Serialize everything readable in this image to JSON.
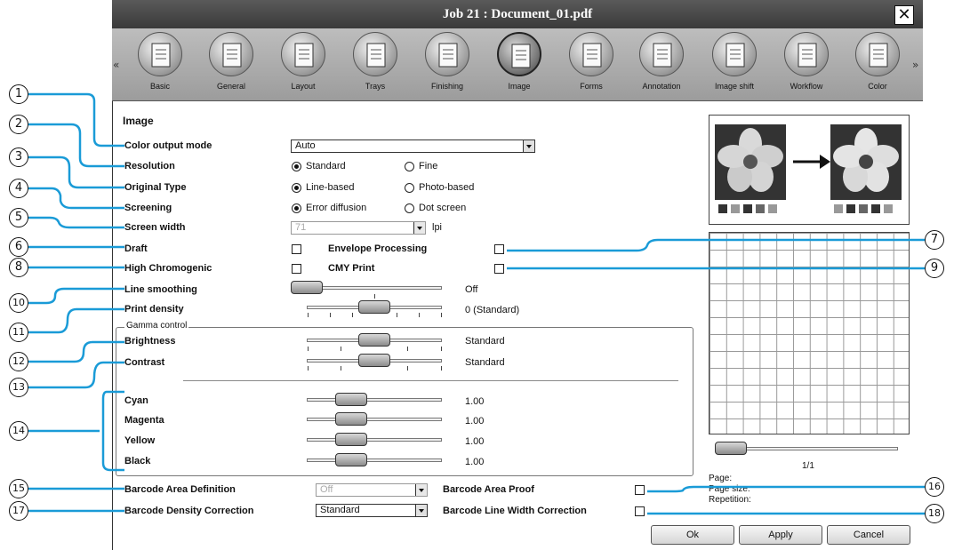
{
  "window": {
    "title": "Job 21 : Document_01.pdf",
    "close_icon": "close-icon"
  },
  "toolbar": {
    "items": [
      {
        "label": "Basic",
        "icon": "basic-icon"
      },
      {
        "label": "General",
        "icon": "general-icon"
      },
      {
        "label": "Layout",
        "icon": "layout-icon"
      },
      {
        "label": "Trays",
        "icon": "trays-icon"
      },
      {
        "label": "Finishing",
        "icon": "finishing-icon"
      },
      {
        "label": "Image",
        "icon": "image-icon",
        "active": true
      },
      {
        "label": "Forms",
        "icon": "forms-icon"
      },
      {
        "label": "Annotation",
        "icon": "annotation-icon"
      },
      {
        "label": "Image shift",
        "icon": "image-shift-icon"
      },
      {
        "label": "Workflow",
        "icon": "workflow-icon"
      },
      {
        "label": "Color",
        "icon": "color-icon"
      }
    ],
    "left_arrow": "«",
    "right_arrow": "»"
  },
  "section_title": "Image",
  "color_output_mode": {
    "label": "Color output mode",
    "value": "Auto"
  },
  "resolution": {
    "label": "Resolution",
    "options": [
      "Standard",
      "Fine"
    ],
    "selected": "Standard"
  },
  "original_type": {
    "label": "Original Type",
    "options": [
      "Line-based",
      "Photo-based"
    ],
    "selected": "Line-based"
  },
  "screening": {
    "label": "Screening",
    "options": [
      "Error diffusion",
      "Dot screen"
    ],
    "selected": "Error diffusion"
  },
  "screen_width": {
    "label": "Screen width",
    "value": "71",
    "unit": "lpi"
  },
  "draft": {
    "label": "Draft",
    "checked": false
  },
  "envelope_processing": {
    "label": "Envelope Processing",
    "checked": false
  },
  "high_chromogenic": {
    "label": "High Chromogenic",
    "checked": false
  },
  "cmy_print": {
    "label": "CMY Print",
    "checked": false
  },
  "line_smoothing": {
    "label": "Line smoothing",
    "value_text": "Off"
  },
  "print_density": {
    "label": "Print density",
    "value_text": "0 (Standard)"
  },
  "gamma_control": {
    "legend": "Gamma control",
    "brightness": {
      "label": "Brightness",
      "value_text": "Standard"
    },
    "contrast": {
      "label": "Contrast",
      "value_text": "Standard"
    },
    "cyan": {
      "label": "Cyan",
      "value_text": "1.00"
    },
    "magenta": {
      "label": "Magenta",
      "value_text": "1.00"
    },
    "yellow": {
      "label": "Yellow",
      "value_text": "1.00"
    },
    "black": {
      "label": "Black",
      "value_text": "1.00"
    }
  },
  "barcode_area_definition": {
    "label": "Barcode Area Definition",
    "value": "Off"
  },
  "barcode_area_proof": {
    "label": "Barcode Area Proof",
    "checked": false
  },
  "barcode_density_correction": {
    "label": "Barcode Density Correction",
    "value": "Standard"
  },
  "barcode_line_width_correction": {
    "label": "Barcode Line Width Correction",
    "checked": false
  },
  "preview": {
    "page_indicator": "1/1",
    "page_label": "Page:",
    "page_size_label": "Page size:",
    "repetition_label": "Repetition:"
  },
  "buttons": {
    "ok": "Ok",
    "apply": "Apply",
    "cancel": "Cancel"
  },
  "callouts": [
    "1",
    "2",
    "3",
    "4",
    "5",
    "6",
    "7",
    "8",
    "9",
    "10",
    "11",
    "12",
    "13",
    "14",
    "15",
    "16",
    "17",
    "18"
  ]
}
